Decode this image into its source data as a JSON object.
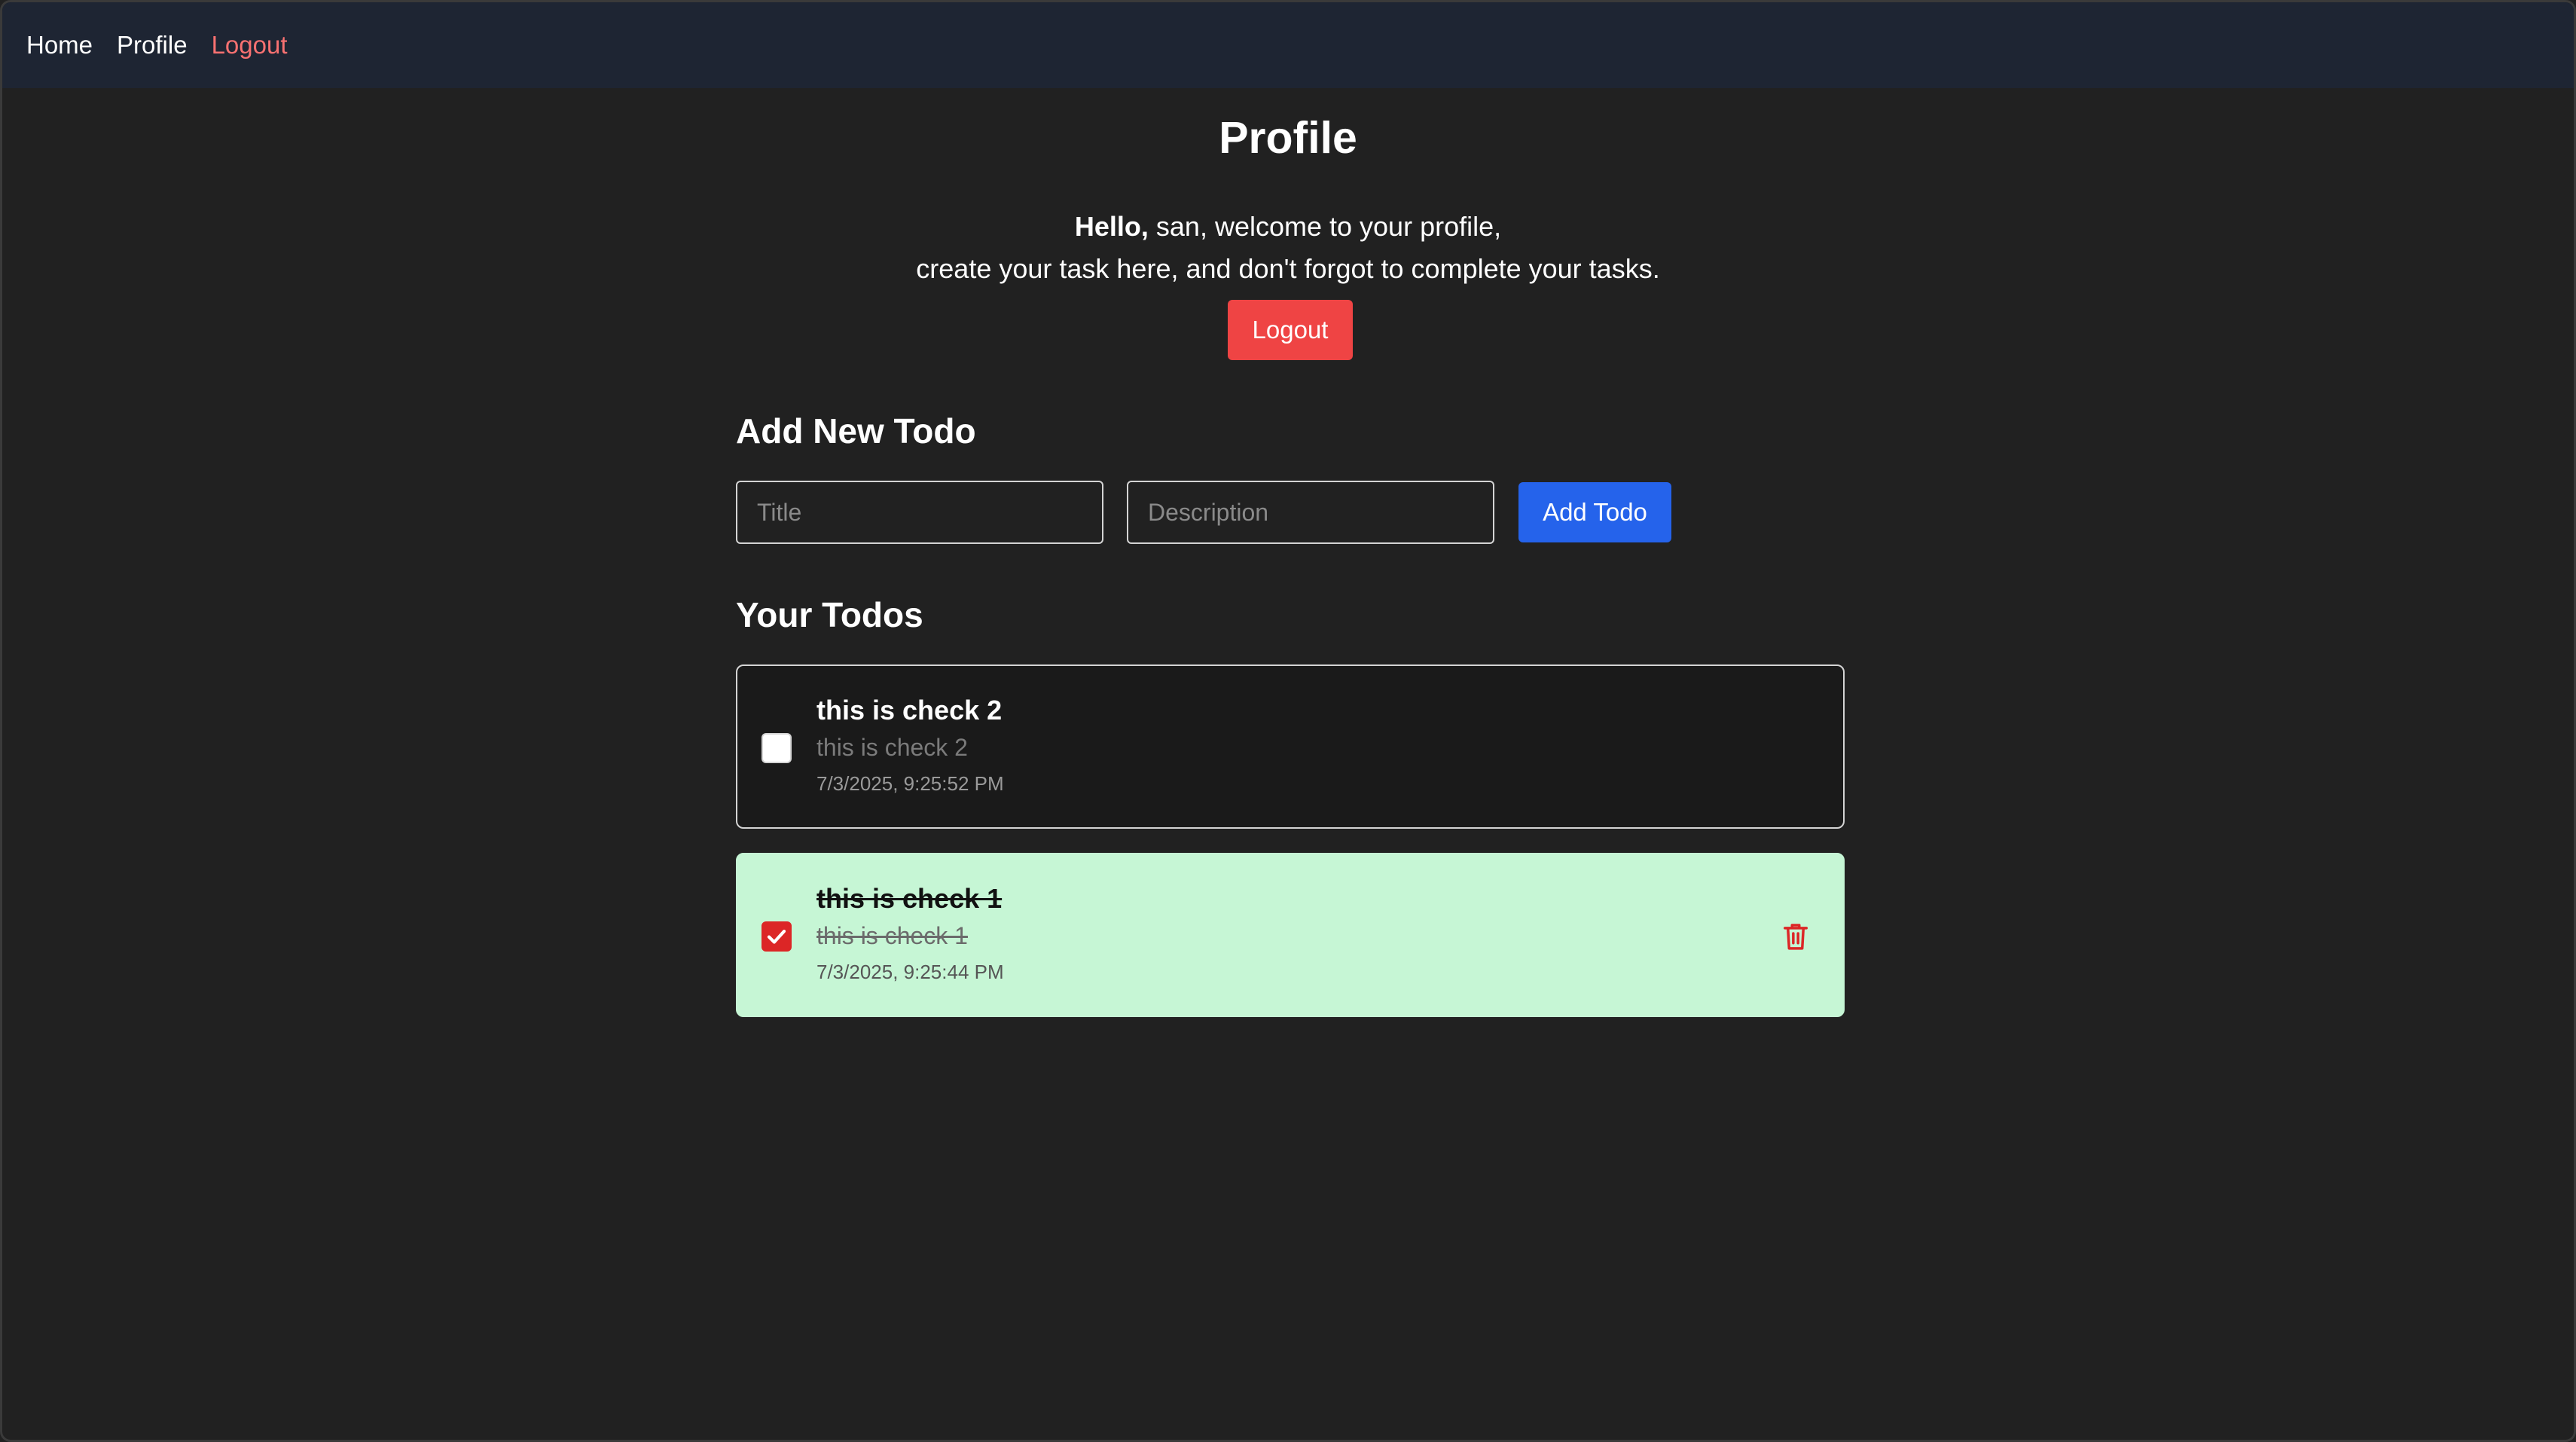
{
  "nav": {
    "home": "Home",
    "profile": "Profile",
    "logout": "Logout"
  },
  "profile": {
    "title": "Profile",
    "hello": "Hello,",
    "welcome_line": "san, welcome to your profile,",
    "instruction_line": "create your task here, and don't forgot to complete your tasks.",
    "logout_button": "Logout"
  },
  "add_todo": {
    "heading": "Add New Todo",
    "title_placeholder": "Title",
    "description_placeholder": "Description",
    "button": "Add Todo"
  },
  "todos": {
    "heading": "Your Todos",
    "items": [
      {
        "title": "this is check 2",
        "description": "this is check 2",
        "timestamp": "7/3/2025, 9:25:52 PM",
        "completed": false
      },
      {
        "title": "this is check 1",
        "description": "this is check 1",
        "timestamp": "7/3/2025, 9:25:44 PM",
        "completed": true
      }
    ]
  },
  "icons": {
    "checkmark": "check-icon",
    "delete": "trash-icon"
  },
  "colors": {
    "background": "#212121",
    "navbar": "#1e2533",
    "logout_red": "#ef4444",
    "nav_logout_text": "#f87171",
    "add_blue": "#2563eb",
    "completed_card": "#c6f6d5",
    "delete_red": "#dc2626"
  }
}
